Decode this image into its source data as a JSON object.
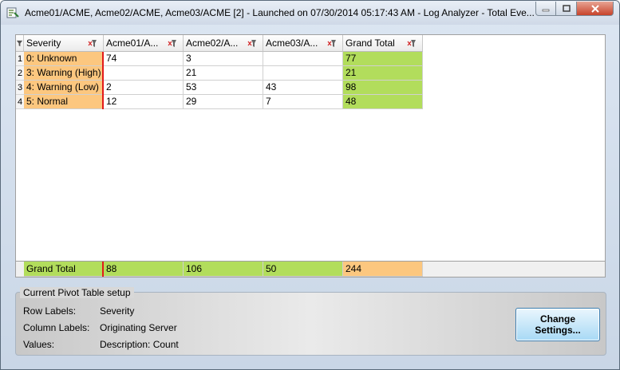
{
  "window": {
    "title": "Acme01/ACME, Acme02/ACME, Acme03/ACME [2] - Launched on 07/30/2014 05:17:43 AM - Log Analyzer - Total Eve..."
  },
  "pivot": {
    "headers": [
      "Severity",
      "Acme01/A...",
      "Acme02/A...",
      "Acme03/A...",
      "Grand Total"
    ],
    "rows": [
      {
        "num": "1",
        "severity": "0: Unknown",
        "acme01": "74",
        "acme02": "3",
        "acme03": "",
        "total": "77"
      },
      {
        "num": "2",
        "severity": "3: Warning (High)",
        "acme01": "",
        "acme02": "21",
        "acme03": "",
        "total": "21"
      },
      {
        "num": "3",
        "severity": "4: Warning (Low)",
        "acme01": "2",
        "acme02": "53",
        "acme03": "43",
        "total": "98"
      },
      {
        "num": "4",
        "severity": "5: Normal",
        "acme01": "12",
        "acme02": "29",
        "acme03": "7",
        "total": "48"
      }
    ],
    "grand_total": {
      "label": "Grand Total",
      "acme01": "88",
      "acme02": "106",
      "acme03": "50",
      "total": "244"
    }
  },
  "setup": {
    "title": "Current Pivot Table setup",
    "row_labels_key": "Row Labels:",
    "row_labels_value": "Severity",
    "column_labels_key": "Column Labels:",
    "column_labels_value": "Originating Server",
    "values_key": "Values:",
    "values_value": "Description: Count",
    "button_label": "Change Settings..."
  },
  "colors": {
    "severity_bg": "#fcc77f",
    "total_bg": "#b2dd5c",
    "accent_red": "#e21b1b"
  }
}
